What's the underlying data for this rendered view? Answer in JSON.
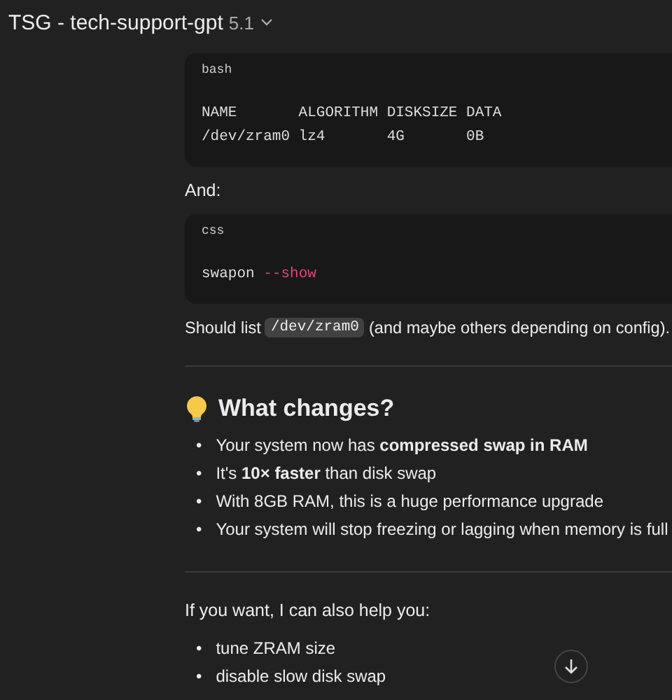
{
  "header": {
    "title": "TSG - tech-support-gpt",
    "version": "5.1"
  },
  "blocks": [
    {
      "kind": "code",
      "language": "bash",
      "lines": [
        "NAME       ALGORITHM DISKSIZE DATA",
        "/dev/zram0 lz4       4G       0B"
      ]
    },
    {
      "kind": "text",
      "text": "And:"
    },
    {
      "kind": "code",
      "language": "css",
      "lines": [
        "swapon"
      ],
      "flag": "--show"
    },
    {
      "kind": "inline",
      "before": "Should list",
      "code": "/dev/zram0",
      "after": "(and maybe others depending on config)."
    },
    {
      "kind": "rule"
    },
    {
      "kind": "heading",
      "text": "What changes?"
    },
    {
      "kind": "list",
      "marker": "•",
      "items": [
        "Your system now has **compressed swap in RAM**",
        "It's **10× faster** than disk swap",
        "With 8GB RAM, this is a huge performance upgrade",
        "Your system will stop freezing or lagging when memory is full"
      ]
    },
    {
      "kind": "rule"
    },
    {
      "kind": "text",
      "text": "If you want, I can also help you:"
    },
    {
      "kind": "list",
      "marker": "•",
      "items": [
        "tune ZRAM size",
        "disable slow disk swap"
      ]
    }
  ]
}
